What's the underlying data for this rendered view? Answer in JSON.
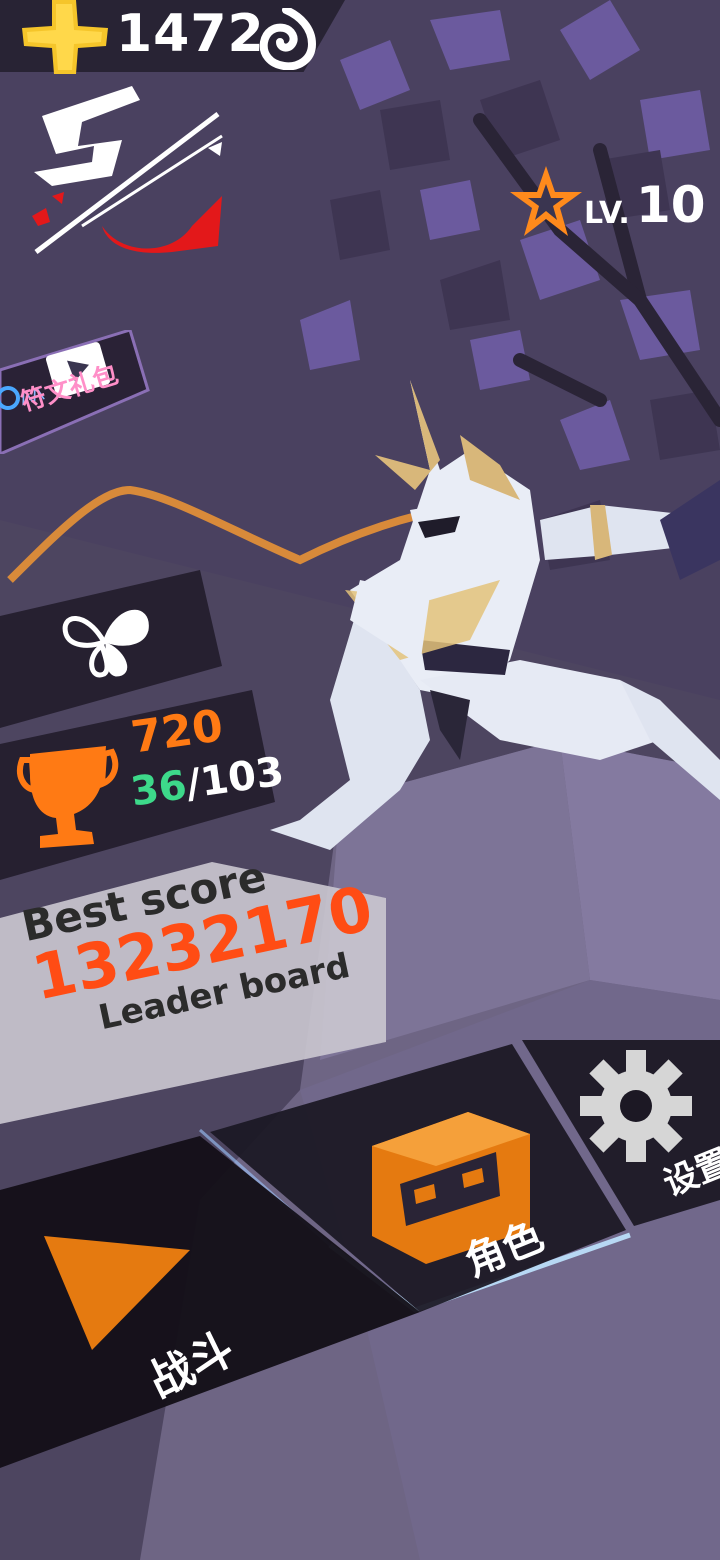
{
  "currency": {
    "gold_amount": "1472",
    "gold_icon": "gold-cross-icon",
    "secondary_icon": "swirl-rune-icon"
  },
  "level": {
    "label": "LV.",
    "value": "10",
    "icon": "star-icon"
  },
  "rune_pack": {
    "label": "符文礼包",
    "icon": "video-play-icon"
  },
  "trophy": {
    "score": "720",
    "count_current": "36",
    "count_separator": "/",
    "count_total": "103",
    "icon": "trophy-icon"
  },
  "best": {
    "label": "Best score",
    "value": "13232170",
    "leaderboard_label": "Leader board"
  },
  "menu": {
    "fight_label": "战斗",
    "role_label": "角色",
    "settings_label": "设置"
  },
  "colors": {
    "accent_orange": "#ff7a14",
    "score_red": "#ff4c14",
    "green": "#3dd98a",
    "gold": "#f5c52a",
    "pink": "#ff8fc8"
  }
}
